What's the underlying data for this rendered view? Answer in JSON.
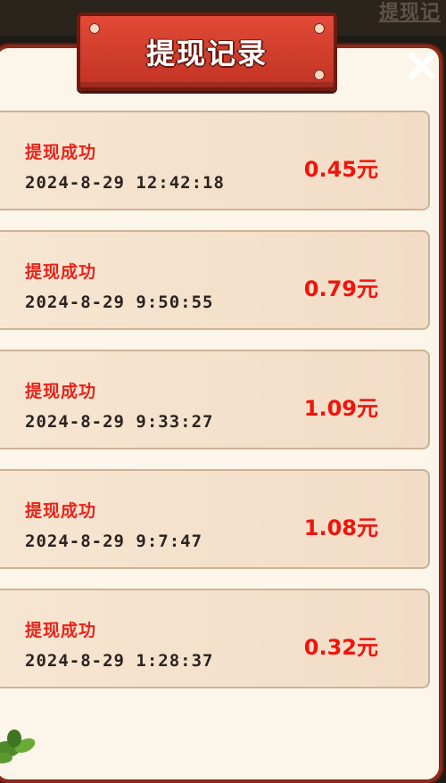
{
  "header": {
    "title": "提现记录",
    "bg_link": "提现记",
    "close_icon": "close-icon"
  },
  "records": [
    {
      "status": "提现成功",
      "time": "2024-8-29  12:42:18",
      "amount": "0.45元"
    },
    {
      "status": "提现成功",
      "time": "2024-8-29  9:50:55",
      "amount": "0.79元"
    },
    {
      "status": "提现成功",
      "time": "2024-8-29  9:33:27",
      "amount": "1.09元"
    },
    {
      "status": "提现成功",
      "time": "2024-8-29  9:7:47",
      "amount": "1.08元"
    },
    {
      "status": "提现成功",
      "time": "2024-8-29  1:28:37",
      "amount": "0.32元"
    }
  ],
  "colors": {
    "accent_red": "#f0140c",
    "banner_red": "#d63e2c",
    "panel_bg": "#fcf6ea",
    "card_bg": "#f4e0cb"
  }
}
